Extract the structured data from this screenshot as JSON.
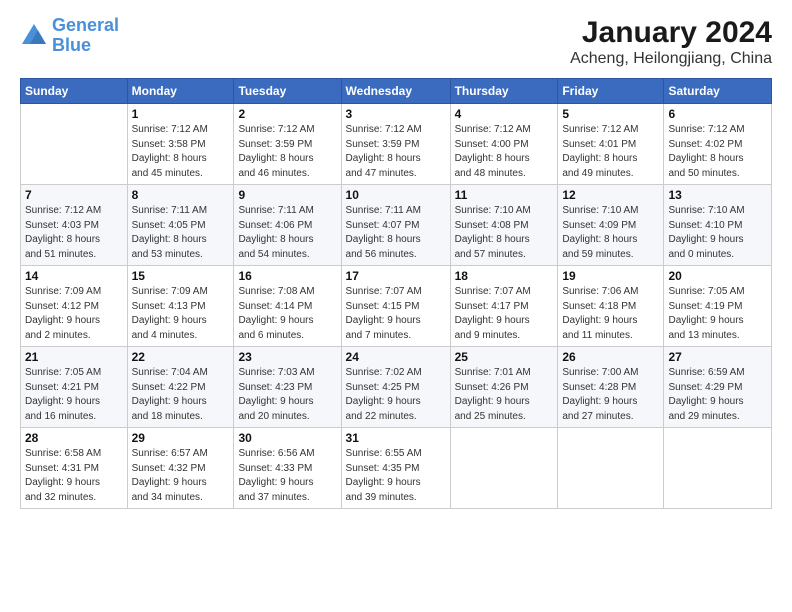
{
  "header": {
    "logo_text_general": "General",
    "logo_text_blue": "Blue",
    "main_title": "January 2024",
    "sub_title": "Acheng, Heilongjiang, China"
  },
  "calendar": {
    "weekdays": [
      "Sunday",
      "Monday",
      "Tuesday",
      "Wednesday",
      "Thursday",
      "Friday",
      "Saturday"
    ],
    "weeks": [
      [
        {
          "day": "",
          "info": ""
        },
        {
          "day": "1",
          "info": "Sunrise: 7:12 AM\nSunset: 3:58 PM\nDaylight: 8 hours\nand 45 minutes."
        },
        {
          "day": "2",
          "info": "Sunrise: 7:12 AM\nSunset: 3:59 PM\nDaylight: 8 hours\nand 46 minutes."
        },
        {
          "day": "3",
          "info": "Sunrise: 7:12 AM\nSunset: 3:59 PM\nDaylight: 8 hours\nand 47 minutes."
        },
        {
          "day": "4",
          "info": "Sunrise: 7:12 AM\nSunset: 4:00 PM\nDaylight: 8 hours\nand 48 minutes."
        },
        {
          "day": "5",
          "info": "Sunrise: 7:12 AM\nSunset: 4:01 PM\nDaylight: 8 hours\nand 49 minutes."
        },
        {
          "day": "6",
          "info": "Sunrise: 7:12 AM\nSunset: 4:02 PM\nDaylight: 8 hours\nand 50 minutes."
        }
      ],
      [
        {
          "day": "7",
          "info": "Sunrise: 7:12 AM\nSunset: 4:03 PM\nDaylight: 8 hours\nand 51 minutes."
        },
        {
          "day": "8",
          "info": "Sunrise: 7:11 AM\nSunset: 4:05 PM\nDaylight: 8 hours\nand 53 minutes."
        },
        {
          "day": "9",
          "info": "Sunrise: 7:11 AM\nSunset: 4:06 PM\nDaylight: 8 hours\nand 54 minutes."
        },
        {
          "day": "10",
          "info": "Sunrise: 7:11 AM\nSunset: 4:07 PM\nDaylight: 8 hours\nand 56 minutes."
        },
        {
          "day": "11",
          "info": "Sunrise: 7:10 AM\nSunset: 4:08 PM\nDaylight: 8 hours\nand 57 minutes."
        },
        {
          "day": "12",
          "info": "Sunrise: 7:10 AM\nSunset: 4:09 PM\nDaylight: 8 hours\nand 59 minutes."
        },
        {
          "day": "13",
          "info": "Sunrise: 7:10 AM\nSunset: 4:10 PM\nDaylight: 9 hours\nand 0 minutes."
        }
      ],
      [
        {
          "day": "14",
          "info": "Sunrise: 7:09 AM\nSunset: 4:12 PM\nDaylight: 9 hours\nand 2 minutes."
        },
        {
          "day": "15",
          "info": "Sunrise: 7:09 AM\nSunset: 4:13 PM\nDaylight: 9 hours\nand 4 minutes."
        },
        {
          "day": "16",
          "info": "Sunrise: 7:08 AM\nSunset: 4:14 PM\nDaylight: 9 hours\nand 6 minutes."
        },
        {
          "day": "17",
          "info": "Sunrise: 7:07 AM\nSunset: 4:15 PM\nDaylight: 9 hours\nand 7 minutes."
        },
        {
          "day": "18",
          "info": "Sunrise: 7:07 AM\nSunset: 4:17 PM\nDaylight: 9 hours\nand 9 minutes."
        },
        {
          "day": "19",
          "info": "Sunrise: 7:06 AM\nSunset: 4:18 PM\nDaylight: 9 hours\nand 11 minutes."
        },
        {
          "day": "20",
          "info": "Sunrise: 7:05 AM\nSunset: 4:19 PM\nDaylight: 9 hours\nand 13 minutes."
        }
      ],
      [
        {
          "day": "21",
          "info": "Sunrise: 7:05 AM\nSunset: 4:21 PM\nDaylight: 9 hours\nand 16 minutes."
        },
        {
          "day": "22",
          "info": "Sunrise: 7:04 AM\nSunset: 4:22 PM\nDaylight: 9 hours\nand 18 minutes."
        },
        {
          "day": "23",
          "info": "Sunrise: 7:03 AM\nSunset: 4:23 PM\nDaylight: 9 hours\nand 20 minutes."
        },
        {
          "day": "24",
          "info": "Sunrise: 7:02 AM\nSunset: 4:25 PM\nDaylight: 9 hours\nand 22 minutes."
        },
        {
          "day": "25",
          "info": "Sunrise: 7:01 AM\nSunset: 4:26 PM\nDaylight: 9 hours\nand 25 minutes."
        },
        {
          "day": "26",
          "info": "Sunrise: 7:00 AM\nSunset: 4:28 PM\nDaylight: 9 hours\nand 27 minutes."
        },
        {
          "day": "27",
          "info": "Sunrise: 6:59 AM\nSunset: 4:29 PM\nDaylight: 9 hours\nand 29 minutes."
        }
      ],
      [
        {
          "day": "28",
          "info": "Sunrise: 6:58 AM\nSunset: 4:31 PM\nDaylight: 9 hours\nand 32 minutes."
        },
        {
          "day": "29",
          "info": "Sunrise: 6:57 AM\nSunset: 4:32 PM\nDaylight: 9 hours\nand 34 minutes."
        },
        {
          "day": "30",
          "info": "Sunrise: 6:56 AM\nSunset: 4:33 PM\nDaylight: 9 hours\nand 37 minutes."
        },
        {
          "day": "31",
          "info": "Sunrise: 6:55 AM\nSunset: 4:35 PM\nDaylight: 9 hours\nand 39 minutes."
        },
        {
          "day": "",
          "info": ""
        },
        {
          "day": "",
          "info": ""
        },
        {
          "day": "",
          "info": ""
        }
      ]
    ]
  }
}
